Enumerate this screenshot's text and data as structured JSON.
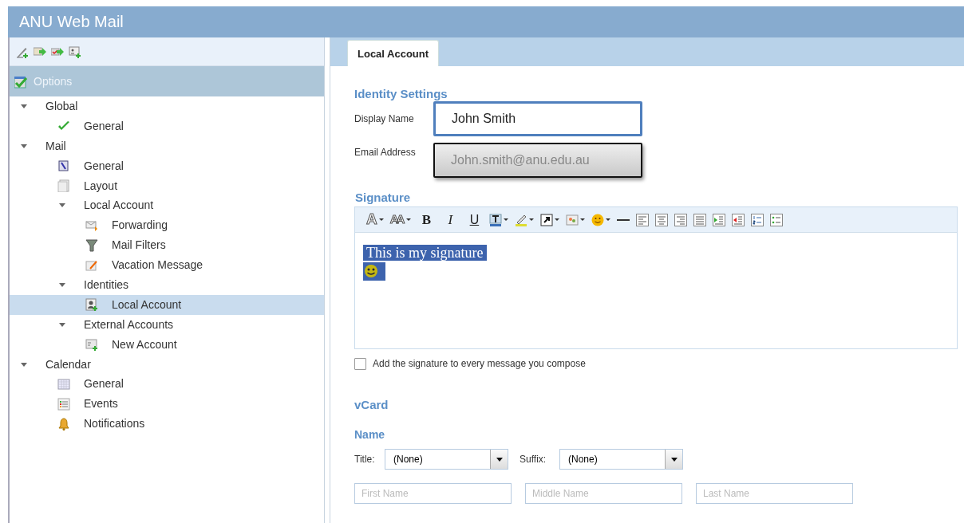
{
  "window": {
    "title": "ANU Web Mail"
  },
  "left_toolbar": [
    {
      "kind": "new"
    },
    {
      "kind": "import"
    },
    {
      "kind": "export"
    },
    {
      "kind": "add-contact"
    }
  ],
  "sidebar": {
    "header": "Options",
    "tree": [
      {
        "label": "Global",
        "expanded": true,
        "children": [
          {
            "label": "General",
            "kind": "check",
            "selected": false
          }
        ]
      },
      {
        "label": "Mail",
        "expanded": true,
        "children": [
          {
            "label": "General",
            "kind": "wand",
            "selected": false
          },
          {
            "label": "Layout",
            "kind": "layout",
            "selected": false
          },
          {
            "label": "Local Account",
            "expanded": true,
            "children": [
              {
                "label": "Forwarding",
                "kind": "forward",
                "selected": false
              },
              {
                "label": "Mail Filters",
                "kind": "filter",
                "selected": false
              },
              {
                "label": "Vacation Message",
                "kind": "vacation",
                "selected": false
              }
            ]
          },
          {
            "label": "Identities",
            "expanded": true,
            "children": [
              {
                "label": "Local Account",
                "kind": "identity",
                "selected": true
              }
            ]
          },
          {
            "label": "External Accounts",
            "expanded": true,
            "children": [
              {
                "label": "New Account",
                "kind": "new-account",
                "selected": false
              }
            ]
          }
        ]
      },
      {
        "label": "Calendar",
        "expanded": true,
        "children": [
          {
            "label": "General",
            "kind": "calendar",
            "selected": false
          },
          {
            "label": "Events",
            "kind": "events",
            "selected": false
          },
          {
            "label": "Notifications",
            "kind": "bell",
            "selected": false
          }
        ]
      }
    ]
  },
  "tabs": [
    {
      "label": "Local Account",
      "selected": true
    }
  ],
  "identity": {
    "heading": "Identity Settings",
    "fields": [
      {
        "label": "Display Name",
        "value": "John Smith",
        "focused": true,
        "disabled": false
      },
      {
        "label": "Email Address",
        "value": "John.smith@anu.edu.au",
        "focused": false,
        "disabled": true
      }
    ]
  },
  "signature": {
    "heading": "Signature",
    "toolbar": [
      {
        "kind": "font",
        "label": "A"
      },
      {
        "kind": "font-size",
        "label": "AA"
      },
      {
        "kind": "bold",
        "label": "B"
      },
      {
        "kind": "italic",
        "label": "I"
      },
      {
        "kind": "underline",
        "label": "U"
      },
      {
        "kind": "text-color"
      },
      {
        "kind": "highlight"
      },
      {
        "kind": "link"
      },
      {
        "kind": "image"
      },
      {
        "kind": "smiley"
      },
      {
        "kind": "rule"
      },
      {
        "kind": "align-left"
      },
      {
        "kind": "align-center"
      },
      {
        "kind": "align-right"
      },
      {
        "kind": "justify"
      },
      {
        "kind": "indent"
      },
      {
        "kind": "outdent"
      },
      {
        "kind": "ordered-list"
      },
      {
        "kind": "bullet-list"
      }
    ],
    "text": "This is my signature",
    "selected": true,
    "checkbox": {
      "label": "Add the signature to every message you compose",
      "checked": false
    }
  },
  "vcard": {
    "heading": "vCard",
    "name_heading": "Name",
    "selects": [
      {
        "label": "Title:",
        "value": "(None)"
      },
      {
        "label": "Suffix:",
        "value": "(None)"
      }
    ],
    "inputs": [
      {
        "placeholder": "First Name"
      },
      {
        "placeholder": "Middle Name"
      },
      {
        "placeholder": "Last Name"
      }
    ]
  }
}
